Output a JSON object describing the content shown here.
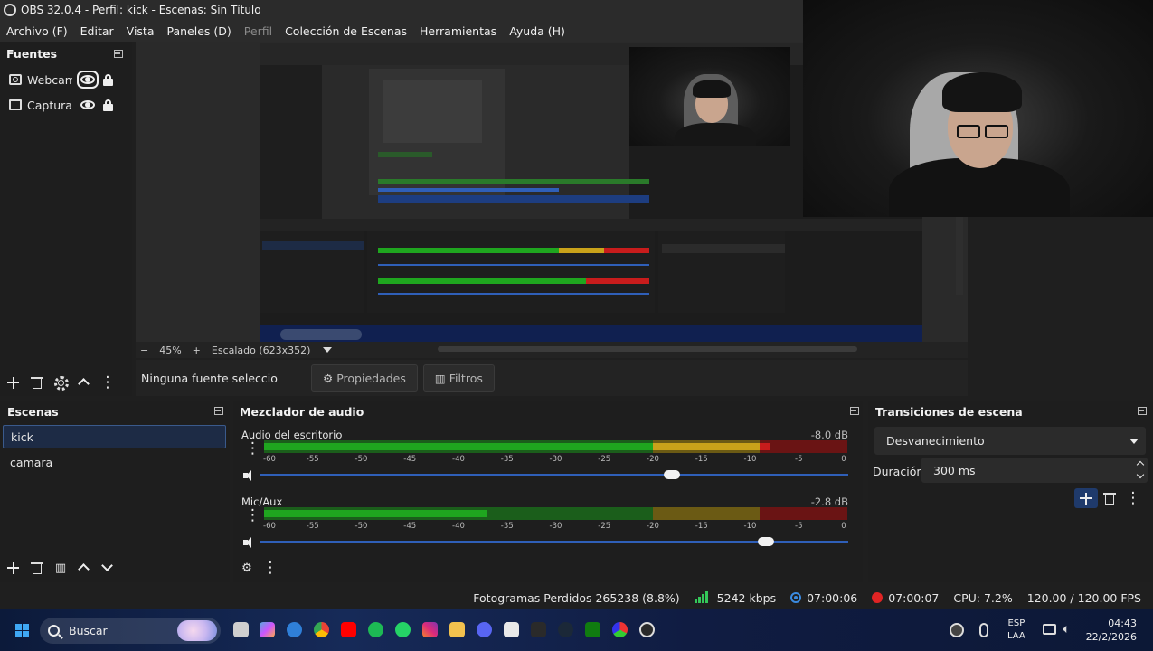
{
  "window": {
    "title": "OBS 32.0.4 - Perfil: kick - Escenas: Sin Título"
  },
  "menu": {
    "items": [
      {
        "label": "Archivo (F)",
        "enabled": true
      },
      {
        "label": "Editar",
        "enabled": true
      },
      {
        "label": "Vista",
        "enabled": true
      },
      {
        "label": "Paneles (D)",
        "enabled": true
      },
      {
        "label": "Perfil",
        "enabled": false
      },
      {
        "label": "Colección de Escenas",
        "enabled": true
      },
      {
        "label": "Herramientas",
        "enabled": true
      },
      {
        "label": "Ayuda (H)",
        "enabled": true
      }
    ]
  },
  "sources": {
    "title": "Fuentes",
    "items": [
      {
        "label": "Webcam",
        "icon": "camera-icon",
        "visible": true,
        "locked": true
      },
      {
        "label": "Captura d",
        "icon": "monitor-icon",
        "visible": true,
        "locked": true
      }
    ]
  },
  "preview": {
    "zoom": "45%",
    "zoom_minus": "−",
    "zoom_plus": "+",
    "scaling": "Escalado (623x352)"
  },
  "context": {
    "no_source": "Ninguna fuente seleccionada",
    "properties_label": "Propiedades",
    "filters_label": "Filtros"
  },
  "scenes": {
    "title": "Escenas",
    "items": [
      {
        "label": "kick",
        "active": true
      },
      {
        "label": "camara",
        "active": false
      }
    ]
  },
  "mixer": {
    "title": "Mezclador de audio",
    "tick_labels": [
      "-60",
      "-55",
      "-50",
      "-45",
      "-40",
      "-35",
      "-30",
      "-25",
      "-20",
      "-15",
      "-10",
      "-5",
      "0"
    ],
    "channels": [
      {
        "name": "Audio del escritorio",
        "db": "-8.0 dB",
        "level_db": -8.0,
        "volume_fraction": 0.7
      },
      {
        "name": "Mic/Aux",
        "db": "-2.8 dB",
        "level_db": -2.8,
        "volume_fraction": 0.86
      }
    ],
    "colors": {
      "green": "#1fa61f",
      "yellow": "#c9a21a",
      "red": "#c81c1c",
      "green_dim": "#1b5e1b",
      "yellow_dim": "#6b5a14",
      "red_dim": "#6a1414"
    }
  },
  "transitions": {
    "title": "Transiciones de escena",
    "selected": "Desvanecimiento",
    "duration_label": "Duración",
    "duration_value": "300 ms"
  },
  "status": {
    "dropped_frames": "Fotogramas Perdidos 265238 (8.8%)",
    "bitrate": "5242 kbps",
    "stream_time": "07:00:06",
    "rec_time": "07:00:07",
    "cpu": "CPU: 7.2%",
    "fps": "120.00 / 120.00 FPS"
  },
  "taskbar": {
    "search_label": "Buscar",
    "lang_top": "ESP",
    "lang_bottom": "LAA",
    "time": "04:43",
    "date": "22/2/2026"
  }
}
